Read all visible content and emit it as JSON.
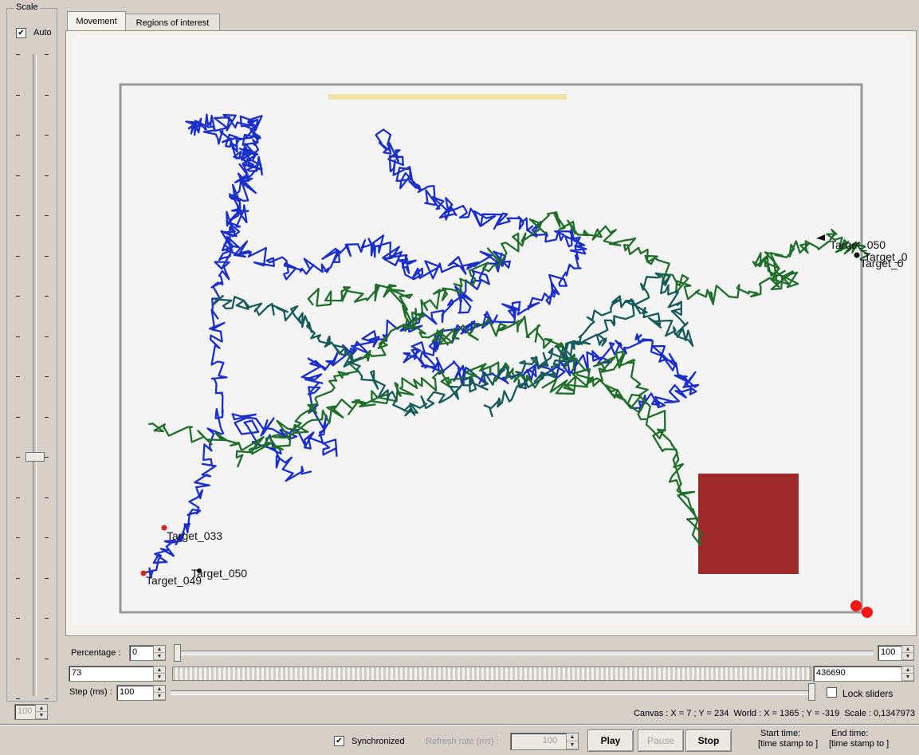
{
  "scale": {
    "group_label": "Scale",
    "auto_label": "Auto",
    "auto_checked": true,
    "value": "100"
  },
  "tabs": [
    {
      "label": "Movement",
      "active": true
    },
    {
      "label": "Regions of interest",
      "active": false
    }
  ],
  "targets": [
    {
      "label": "Target_050",
      "color": "#000000"
    },
    {
      "label": "Target_0",
      "color": "#000000"
    },
    {
      "label": "Target_0",
      "color": "#000000"
    },
    {
      "label": "Target_033",
      "color": "#e02020"
    },
    {
      "label": "Target_049",
      "color": "#e02020"
    },
    {
      "label": "Target_050",
      "color": "#000000"
    }
  ],
  "colors": {
    "track_blue": "#1a2ec8",
    "track_green": "#1f6e2a",
    "track_teal": "#165a5a",
    "region_red": "#9e2a2b",
    "region_yellow": "#efe2a6"
  },
  "controls": {
    "percentage_label": "Percentage :",
    "percentage_value": "0",
    "percentage_max": "100",
    "start_value": "73",
    "end_value": "436690",
    "step_label": "Step (ms) :",
    "step_value": "100",
    "lock_label": "Lock sliders"
  },
  "status": "Canvas : X = 7 ; Y = 234  World : X = 1365 ; Y = -319  Scale : 0,1347973",
  "bottom": {
    "synchronized_label": "Synchronized",
    "refresh_label": "Refresh rate (ms) :",
    "refresh_value": "100",
    "play": "Play",
    "pause": "Pause",
    "stop": "Stop",
    "start_time_label": "Start time:",
    "start_time_value": "[time stamp to ]",
    "end_time_label": "End time:",
    "end_time_value": "[time stamp to ]"
  }
}
